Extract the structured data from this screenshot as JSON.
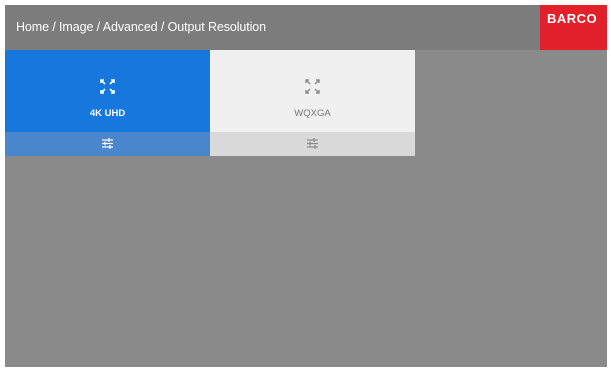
{
  "header": {
    "breadcrumb": "Home / Image / Advanced / Output Resolution",
    "logo_text": "BARCO"
  },
  "tiles": [
    {
      "label": "4K UHD",
      "selected": true,
      "icon": "expand-icon",
      "settings_icon": "settings-sliders-icon"
    },
    {
      "label": "WQXGA",
      "selected": false,
      "icon": "expand-icon",
      "settings_icon": "settings-sliders-icon"
    }
  ],
  "colors": {
    "header_bg": "#7c7c7c",
    "screen_bg": "#8a8a8a",
    "logo_bg": "#e2202a",
    "selected_tile": "#1677dc",
    "selected_tile_settings": "#4a86cc",
    "unselected_tile": "#f0f0f0",
    "unselected_tile_settings": "#d9d9d9"
  }
}
